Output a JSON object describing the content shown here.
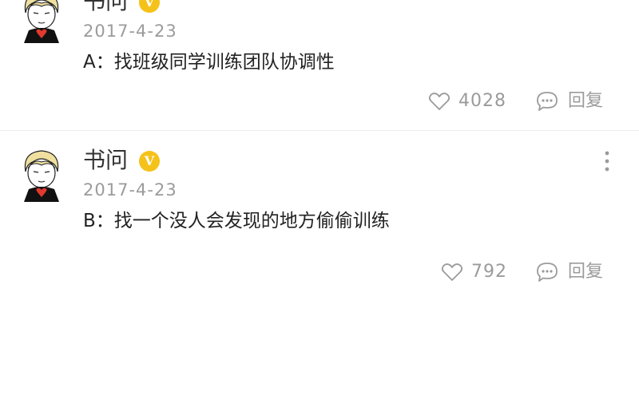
{
  "comments": [
    {
      "author": "书问",
      "verified_badge": "V",
      "date": "2017-4-23",
      "text": "A：找班级同学训练团队协调性",
      "likes": "4028",
      "reply_label": "回复"
    },
    {
      "author": "书问",
      "verified_badge": "V",
      "date": "2017-4-23",
      "text": "B：找一个没人会发现的地方偷偷训练",
      "likes": "792",
      "reply_label": "回复"
    }
  ],
  "icons": {
    "like": "heart-outline-icon",
    "reply": "chat-bubble-icon",
    "more": "vertical-ellipsis-icon"
  },
  "colors": {
    "badge": "#f5c21a",
    "muted_text": "#9b9b9b"
  }
}
